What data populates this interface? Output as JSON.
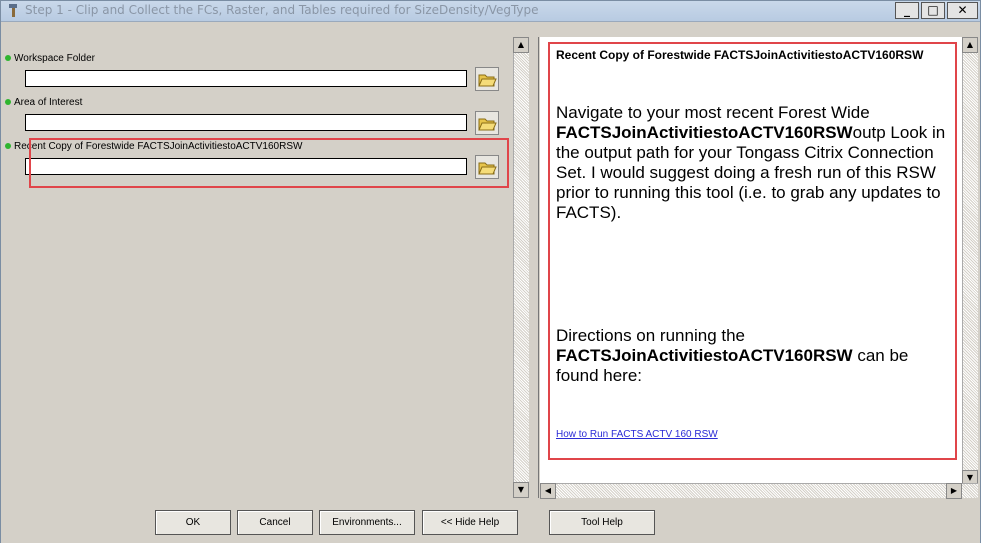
{
  "window": {
    "title": "Step 1 - Clip and Collect the FCs, Raster, and Tables required for SizeDensity/VegType",
    "min_label": "_",
    "max_label": "□",
    "close_label": "✕"
  },
  "params": [
    {
      "label": "Workspace Folder",
      "value": ""
    },
    {
      "label": "Area of Interest",
      "value": ""
    },
    {
      "label": "Recent Copy of Forestwide FACTSJoinActivitiestoACTV160RSW",
      "value": ""
    }
  ],
  "help": {
    "title": "Recent Copy of Forestwide FACTSJoinActivitiestoACTV160RSW",
    "p1_part1": "Navigate to your most recent Forest Wide ",
    "p1_bold": "FACTSJoinActivitiestoACTV160RSW",
    "p1_part2": "outp",
    "p1_part3": " Look in the output path for your Tongass Citrix Connection Set. I would suggest doing a fresh run of this RSW prior to running this tool (i.e. to grab any updates to FACTS).",
    "p2_part1": "Directions on running the ",
    "p2_bold": "FACTSJoinActivitiestoACTV160RSW",
    "p2_part2": " can be found here:",
    "link": "How to Run FACTS ACTV 160 RSW"
  },
  "buttons": {
    "ok": "OK",
    "cancel": "Cancel",
    "environments": "Environments...",
    "hide_help": "<< Hide Help",
    "tool_help": "Tool Help"
  },
  "colors": {
    "highlight": "#e0454a",
    "required_dot": "#2fb52f",
    "link": "#2b2bd6"
  }
}
